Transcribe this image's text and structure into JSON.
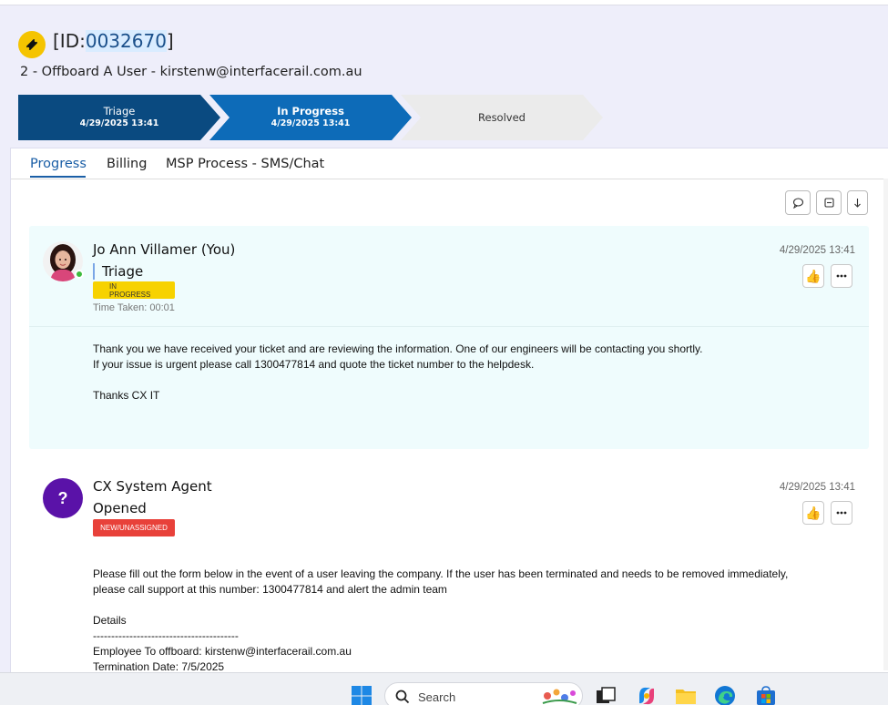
{
  "ticket": {
    "id_prefix": "[ID:",
    "id_number": "0032670",
    "id_suffix": "]",
    "title": "2 - Offboard A User - kirstenw@interfacerail.com.au"
  },
  "stages": [
    {
      "label": "Triage",
      "date": "4/29/2025 13:41"
    },
    {
      "label": "In Progress",
      "date": "4/29/2025 13:41"
    },
    {
      "label": "Resolved",
      "date": ""
    }
  ],
  "tabs": [
    {
      "label": "Progress",
      "active": true
    },
    {
      "label": "Billing",
      "active": false
    },
    {
      "label": "MSP Process - SMS/Chat",
      "active": false
    }
  ],
  "entries": [
    {
      "author": "Jo Ann Villamer (You)",
      "stage": "Triage",
      "badge": "IN PROGRESS",
      "time_taken": "Time Taken: 00:01",
      "timestamp": "4/29/2025 13:41",
      "message": [
        "Thank you we have received your ticket and are reviewing the information. One of our engineers will be contacting you shortly.",
        "If your issue is urgent please call 1300477814 and quote the ticket number to the helpdesk.",
        "",
        "Thanks CX IT"
      ]
    },
    {
      "author": "CX System Agent",
      "avatar_glyph": "?",
      "stage": "Opened",
      "badge": "NEW/UNASSIGNED",
      "timestamp": "4/29/2025 13:41",
      "message": [
        "Please fill out the form below in the event of a user leaving the company. If the user has been terminated and needs to be removed immediately,",
        "please call support at this number: 1300477814 and alert the admin team",
        "",
        "Details",
        "----------------------------------------",
        "Employee To offboard: kirstenw@interfacerail.com.au",
        "Termination Date: 7/5/2025"
      ]
    }
  ],
  "taskbar": {
    "search_placeholder": "Search"
  },
  "colors": {
    "stage_triage": "#0a4a80",
    "stage_in_progress": "#0d6bb8",
    "stage_resolved": "#ebebeb",
    "badge_in_progress": "#f7d200",
    "badge_new": "#e8413a",
    "tab_active": "#1a5ea6"
  }
}
